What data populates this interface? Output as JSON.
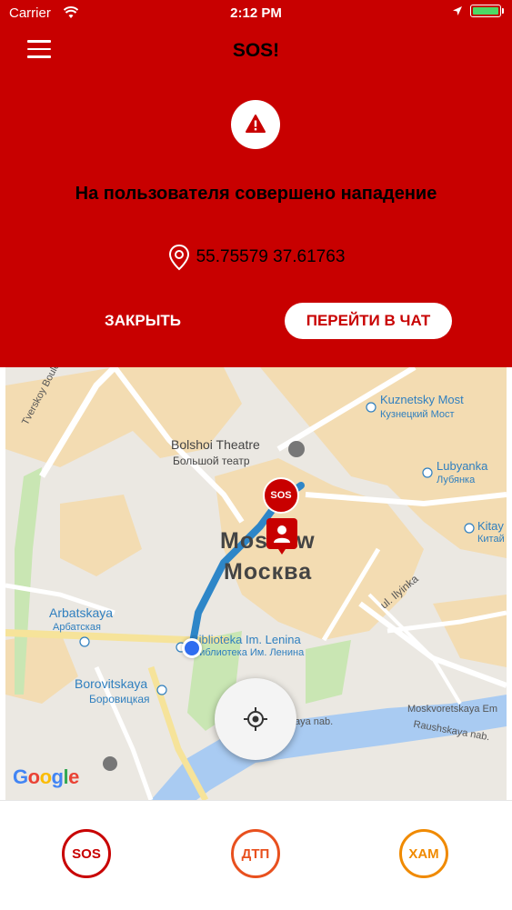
{
  "status_bar": {
    "carrier": "Carrier",
    "time": "2:12 PM"
  },
  "header": {
    "title": "SOS!",
    "message": "На пользователя совершено нападение",
    "coordinates": "55.75579 37.61763",
    "close_label": "ЗАКРЫТЬ",
    "chat_label": "ПЕРЕЙТИ В ЧАТ"
  },
  "map": {
    "labels": {
      "kuznetsky_en": "Kuznetsky Most",
      "kuznetsky_ru": "Кузнецкий Мост",
      "bolshoi_en": "Bolshoi Theatre",
      "bolshoi_ru": "Большой театр",
      "lubyanka_en": "Lubyanka",
      "lubyanka_ru": "Лубянка",
      "kitay_en": "Kitay",
      "kitay_ru": "Китай",
      "moscow_en": "Moscow",
      "moscow_ru": "Москва",
      "arbatskaya_en": "Arbatskaya",
      "arbatskaya_ru": "Арбатская",
      "lenina_en": "Biblioteka Im. Lenina",
      "lenina_ru": "Библиотека Им. Ленина",
      "borovitskaya_en": "Borovitskaya",
      "borovitskaya_ru": "Боровицкая",
      "tverskoy": "Tverskoy Boulevard",
      "ilyinka": "ul. Ilyinka",
      "moskvoretskaya": "Moskvoretskaya Em",
      "raushskaya": "Raushskaya nab.",
      "nab": "aya nab."
    },
    "sos_marker_label": "SOS",
    "google_logo": "Google"
  },
  "categories": [
    {
      "label": "SOS",
      "color": "#c80000"
    },
    {
      "label": "ДТП",
      "color": "#e8501e"
    },
    {
      "label": "ХАМ",
      "color": "#f08a00"
    }
  ],
  "colors": {
    "accent": "#c80000",
    "route": "#2e86c8",
    "user_dot": "#2f6df0"
  }
}
